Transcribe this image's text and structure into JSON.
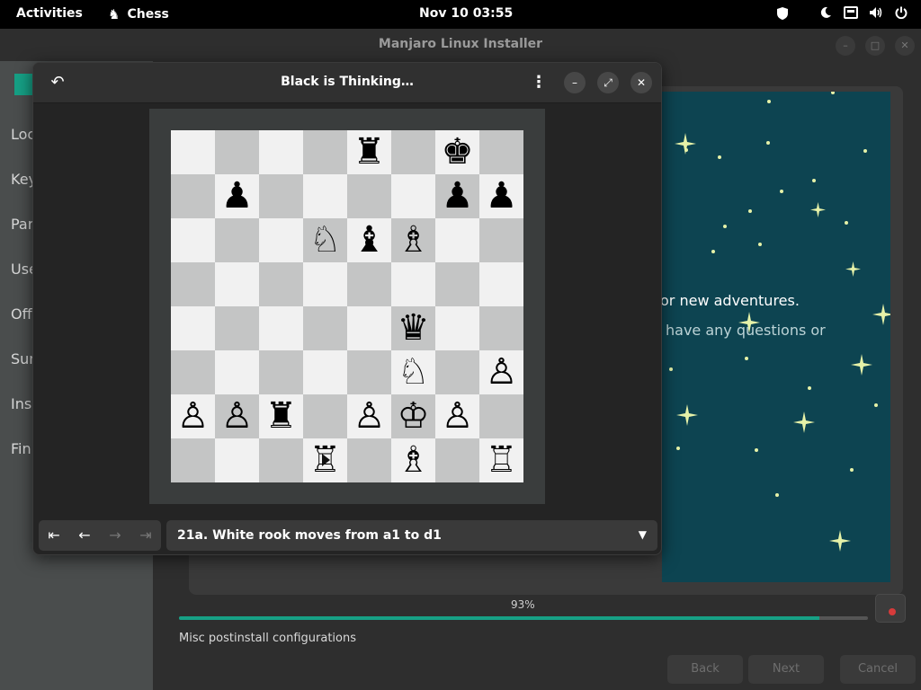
{
  "topbar": {
    "activities": "Activities",
    "app_name": "Chess",
    "clock": "Nov 10  03:55",
    "tray_icons": [
      "shield-icon",
      "night-light-icon",
      "network-icon",
      "volume-icon",
      "power-icon"
    ]
  },
  "installer": {
    "title": "Manjaro Linux Installer",
    "sidebar": {
      "items": [
        {
          "label": "Loc"
        },
        {
          "label": "Key"
        },
        {
          "label": "Par"
        },
        {
          "label": "Use"
        },
        {
          "label": "Off"
        },
        {
          "label": "Sun"
        },
        {
          "label": "Ins"
        },
        {
          "label": "Fini"
        }
      ]
    },
    "slide": {
      "text1": "or new adventures.",
      "text2": "have any questions or"
    },
    "progress": {
      "label": "93%",
      "value": 0.93
    },
    "status": "Misc postinstall configurations",
    "buttons": {
      "back": "Back",
      "next": "Next",
      "cancel": "Cancel"
    },
    "accent_color": "#16a085"
  },
  "chess": {
    "title": "Black is Thinking…",
    "board": {
      "orientation": "white-bottom",
      "rows": [
        [
          "",
          "",
          "",
          "",
          "bR",
          "",
          "bK",
          ""
        ],
        [
          "",
          "bP",
          "",
          "",
          "",
          "",
          "bP",
          "bP"
        ],
        [
          "",
          "",
          "",
          "wN",
          "bB",
          "wB",
          "",
          ""
        ],
        [
          "",
          "",
          "",
          "",
          "",
          "",
          "",
          ""
        ],
        [
          "",
          "",
          "",
          "",
          "",
          "bQ",
          "",
          ""
        ],
        [
          "",
          "",
          "",
          "",
          "",
          "wN",
          "",
          "wP"
        ],
        [
          "wP",
          "wP",
          "bR",
          "",
          "wP",
          "wK",
          "wP",
          ""
        ],
        [
          "",
          "",
          "",
          "wR",
          "",
          "wB",
          "",
          "wR"
        ]
      ]
    },
    "history": {
      "current": "21a. White rook moves from a1 to d1",
      "nav_icons": [
        "first-move-icon",
        "previous-move-icon",
        "next-move-icon",
        "last-move-icon"
      ]
    }
  }
}
